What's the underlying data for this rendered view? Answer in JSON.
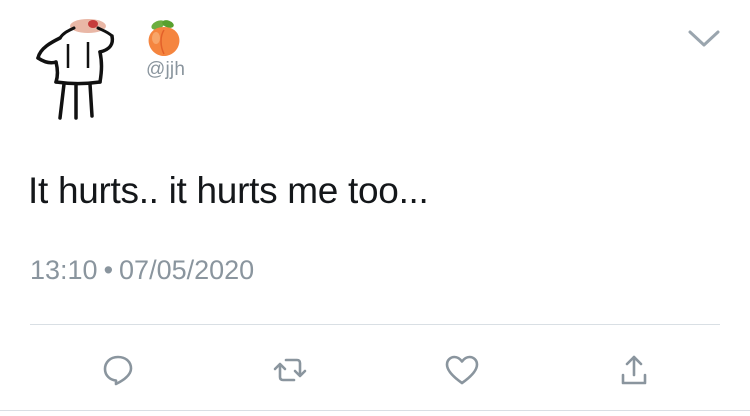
{
  "author": {
    "display_name_emoji": "peach-emoji",
    "handle": "@jjh",
    "avatar": "cartoon-stick-figure-avatar"
  },
  "tweet": {
    "text": "It hurts.. it hurts me too...",
    "time": "13:10",
    "separator": "•",
    "date": "07/05/2020"
  },
  "actions": [
    {
      "name": "reply",
      "icon": "reply-icon"
    },
    {
      "name": "retweet",
      "icon": "retweet-icon"
    },
    {
      "name": "like",
      "icon": "heart-icon"
    },
    {
      "name": "share",
      "icon": "share-icon"
    }
  ],
  "colors": {
    "text": "#14171a",
    "secondary": "#8a959e",
    "divider": "#d9dfe4",
    "peach": "#f5853f"
  }
}
